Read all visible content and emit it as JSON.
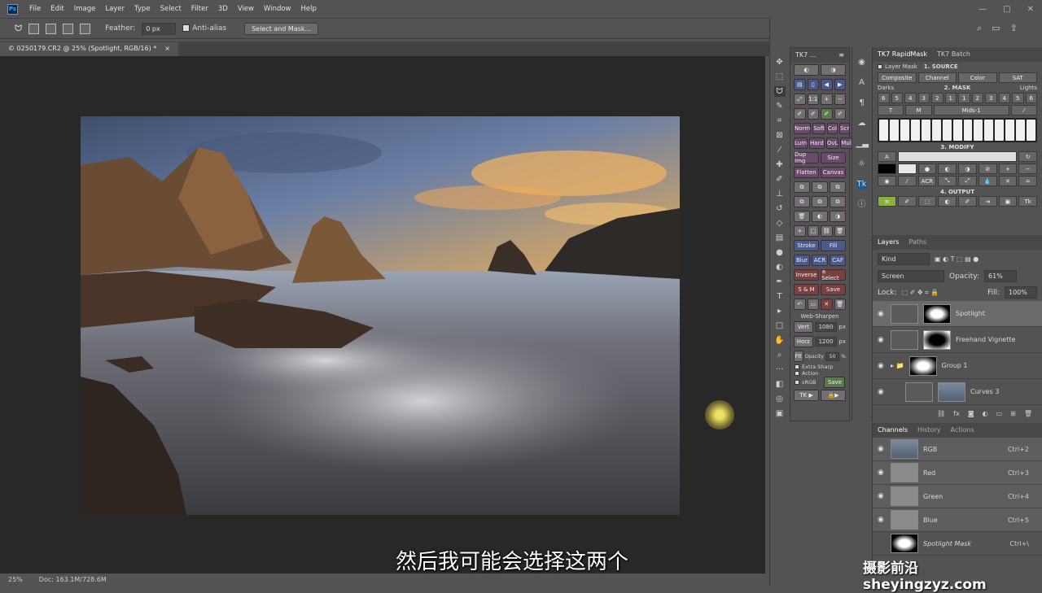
{
  "app": {
    "logo_text": "Ps"
  },
  "menu": [
    "File",
    "Edit",
    "Image",
    "Layer",
    "Type",
    "Select",
    "Filter",
    "3D",
    "View",
    "Window",
    "Help"
  ],
  "window_controls": [
    "—",
    "□",
    "✕"
  ],
  "options": {
    "feather_label": "Feather:",
    "feather_value": "0 px",
    "antialias_label": "Anti-alias",
    "select_mask_label": "Select and Mask..."
  },
  "doc_tab": {
    "title": "© 0250179.CR2 @ 25% (Spotlight, RGB/16) *",
    "close": "×"
  },
  "status": {
    "zoom": "25%",
    "doc": "Doc: 163.1M/728.6M"
  },
  "subtitle": "然后我可能会选择这两个",
  "watermark": "摄影前沿 sheyingzyz.com",
  "tk_panel": {
    "title": "TK7 ...",
    "rows": [
      [
        "Norm",
        "Soft",
        "Col",
        "Scr"
      ],
      [
        "Lum",
        "Hard",
        "OvL",
        "Mult"
      ],
      [
        "Dup Img",
        "Size"
      ],
      [
        "Flatten",
        "Canvas"
      ],
      [
        "Stroke",
        "Fill"
      ],
      [
        "Blur",
        "ACR",
        "CAF"
      ],
      [
        "Inverse",
        "± Select"
      ],
      [
        "S & M",
        "Save"
      ]
    ],
    "web_sharpen": "Web-Sharpen",
    "vert_label": "Vert",
    "vert_value": "1080",
    "vert_unit": "px",
    "horz_label": "Horz",
    "horz_value": "1200",
    "horz_unit": "px",
    "fit_label": "Fit",
    "opacity_label": "Opacity",
    "opacity_value": "50",
    "opacity_unit": "%",
    "extra_sharp": "Extra Sharp",
    "action": "Action",
    "srgb": "sRGB",
    "save": "Save",
    "tk_run": "TK ▶"
  },
  "rapidmask": {
    "tabs": [
      "TK7 RapidMask",
      "TK7 Batch"
    ],
    "layer_mask": "Layer Mask",
    "source_title": "1. SOURCE",
    "source_btns": [
      "Composite",
      "Channel",
      "Color",
      "SAT"
    ],
    "mask_title": "2. MASK",
    "darks": "Darks",
    "lights": "Lights",
    "dark_nums": [
      "6",
      "5",
      "4",
      "3",
      "2",
      "1"
    ],
    "light_nums": [
      "1",
      "2",
      "3",
      "4",
      "5",
      "6"
    ],
    "mids": "Mids-1",
    "modify_title": "3. MODIFY",
    "output_title": "4. OUTPUT"
  },
  "layers": {
    "tabs": [
      "Layers",
      "Paths"
    ],
    "kind": "Kind",
    "blend": "Screen",
    "opacity_label": "Opacity:",
    "opacity_value": "61%",
    "lock_label": "Lock:",
    "fill_label": "Fill:",
    "fill_value": "100%",
    "items": [
      {
        "name": "Spotlight"
      },
      {
        "name": "Freehand Vignette"
      },
      {
        "name": "Group 1"
      },
      {
        "name": "Curves 3"
      }
    ]
  },
  "channels": {
    "tabs": [
      "Channels",
      "History",
      "Actions"
    ],
    "items": [
      {
        "name": "RGB",
        "shortcut": "Ctrl+2"
      },
      {
        "name": "Red",
        "shortcut": "Ctrl+3"
      },
      {
        "name": "Green",
        "shortcut": "Ctrl+4"
      },
      {
        "name": "Blue",
        "shortcut": "Ctrl+5"
      },
      {
        "name": "Spotlight Mask",
        "shortcut": "Ctrl+\\"
      }
    ]
  }
}
